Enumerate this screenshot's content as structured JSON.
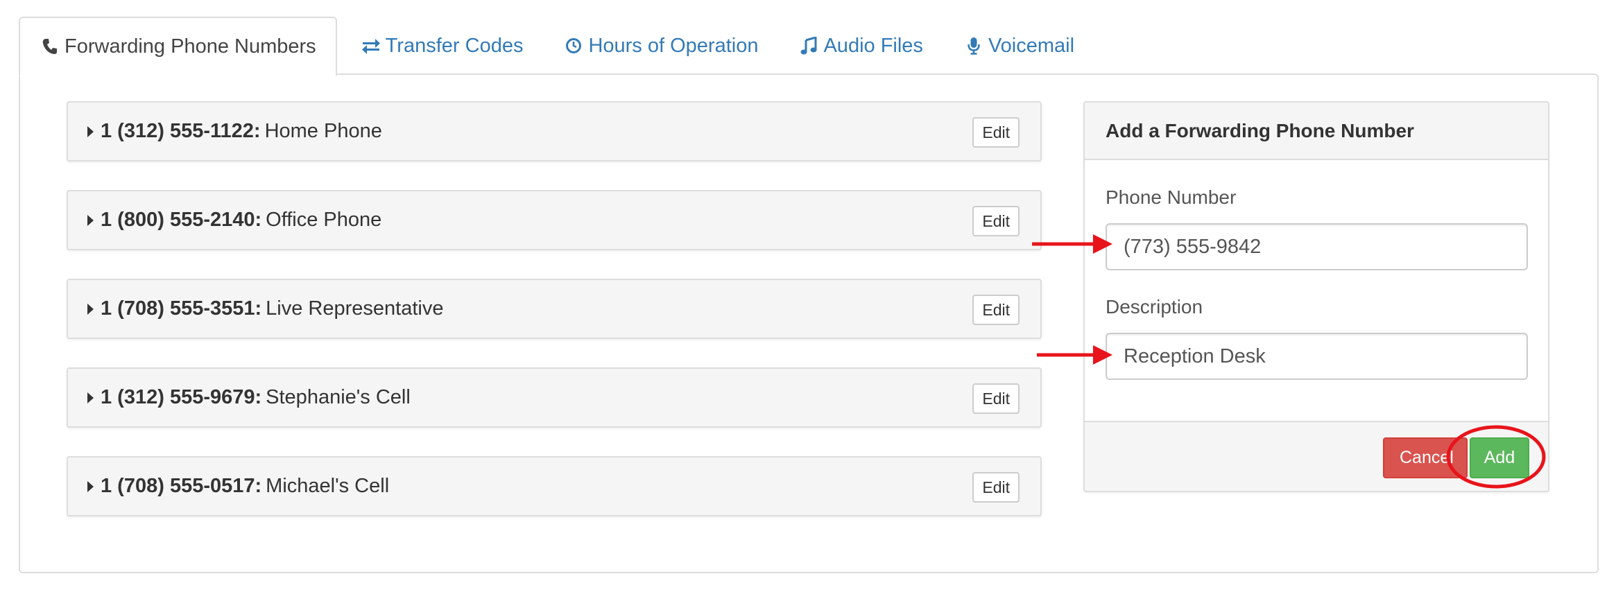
{
  "tabs": [
    {
      "label": "Forwarding Phone Numbers",
      "icon": "phone-icon",
      "active": true
    },
    {
      "label": "Transfer Codes",
      "icon": "exchange-icon",
      "active": false
    },
    {
      "label": "Hours of Operation",
      "icon": "clock-icon",
      "active": false
    },
    {
      "label": "Audio Files",
      "icon": "music-icon",
      "active": false
    },
    {
      "label": "Voicemail",
      "icon": "microphone-icon",
      "active": false
    }
  ],
  "phones": [
    {
      "number": "1 (312) 555-1122:",
      "description": "Home Phone",
      "edit_label": "Edit"
    },
    {
      "number": "1 (800) 555-2140:",
      "description": "Office Phone",
      "edit_label": "Edit"
    },
    {
      "number": "1 (708) 555-3551:",
      "description": "Live Representative",
      "edit_label": "Edit"
    },
    {
      "number": "1 (312) 555-9679:",
      "description": "Stephanie's Cell",
      "edit_label": "Edit"
    },
    {
      "number": "1 (708) 555-0517:",
      "description": "Michael's Cell",
      "edit_label": "Edit"
    }
  ],
  "form": {
    "title": "Add a Forwarding Phone Number",
    "phone_label": "Phone Number",
    "phone_value": "(773) 555-9842",
    "description_label": "Description",
    "description_value": "Reception Desk",
    "cancel_label": "Cancel",
    "add_label": "Add"
  },
  "colors": {
    "link": "#337ab7",
    "cancel": "#d9534f",
    "add": "#5cb85c",
    "annotation": "#e8141b"
  }
}
